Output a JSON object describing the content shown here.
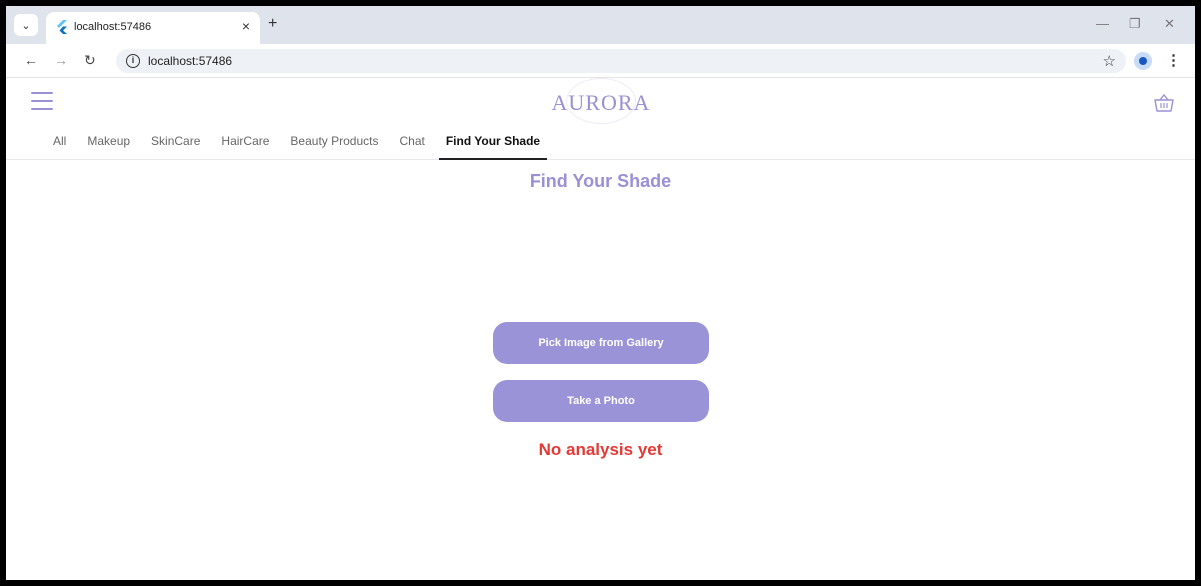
{
  "browser": {
    "tab_title": "localhost:57486",
    "url": "localhost:57486"
  },
  "app": {
    "logo": "AURORA",
    "nav_tabs": [
      "All",
      "Makeup",
      "SkinCare",
      "HairCare",
      "Beauty Products",
      "Chat",
      "Find Your Shade"
    ],
    "active_tab": "Find Your Shade"
  },
  "main": {
    "title": "Find Your Shade",
    "pick_button_label": "Pick Image from Gallery",
    "photo_button_label": "Take a Photo",
    "status": "No analysis yet"
  },
  "colors": {
    "accent": "#9b8fd6",
    "button": "#9b93d8",
    "status": "#e53935"
  }
}
